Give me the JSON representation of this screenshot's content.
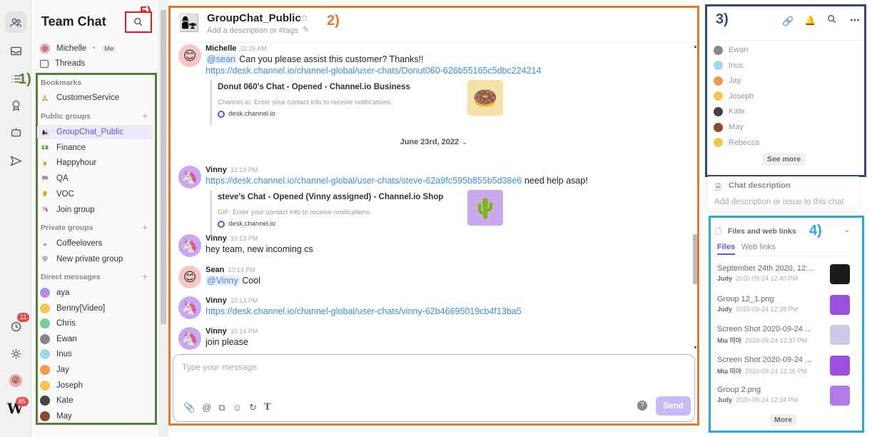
{
  "app": {
    "title": "Team Chat"
  },
  "rail": {
    "badge_notifications": "11",
    "badge_user": "85"
  },
  "sidebar": {
    "me": {
      "name": "Michelle",
      "tag": "Me"
    },
    "threads": "Threads",
    "bookmarks_label": "Bookmarks",
    "bookmarks": [
      {
        "label": "CustomerService",
        "icon": "🙏"
      }
    ],
    "public_label": "Public groups",
    "public_groups": [
      {
        "label": "GroupChat_Public",
        "icon": "👩‍👧"
      },
      {
        "label": "Finance",
        "icon": "💵"
      },
      {
        "label": "Happyhour",
        "icon": "🍺"
      },
      {
        "label": "QA",
        "icon": "🏁"
      },
      {
        "label": "VOC",
        "icon": "👂"
      },
      {
        "label": "Join group",
        "icon": "🦄"
      }
    ],
    "private_label": "Private groups",
    "private_groups": [
      {
        "label": "Coffeelovers",
        "icon": "☕"
      },
      {
        "label": "New private group",
        "icon": "😝"
      }
    ],
    "dm_label": "Direct messages",
    "dms": [
      {
        "label": "aya",
        "color": "#b78be8"
      },
      {
        "label": "Benny[Video]",
        "color": "#f2c94c"
      },
      {
        "label": "Chris",
        "color": "#6fcf97"
      },
      {
        "label": "Ewan",
        "color": "#888888"
      },
      {
        "label": "Inus",
        "color": "#9fd6f0"
      },
      {
        "label": "Jay",
        "color": "#f2994a"
      },
      {
        "label": "Joseph",
        "color": "#f2c94c"
      },
      {
        "label": "Kate",
        "color": "#444444"
      },
      {
        "label": "May",
        "color": "#8b4a2b"
      }
    ]
  },
  "annotations": {
    "a1": "1)",
    "a2": "2)",
    "a3": "3)",
    "a4": "4)",
    "a5": "5)"
  },
  "channel": {
    "name": "GroupChat_Public",
    "icon": "👩‍👧",
    "description_placeholder": "Add a description or #tags"
  },
  "messages": [
    {
      "name": "Michelle",
      "time": "11:26 AM",
      "mention": "@sean",
      "text": " Can you please assist this customer? Thanks!!",
      "link": "https://desk.channel.io/channel-global/user-chats/Donut060-626b55165c5dbc224214",
      "avatar": "😊",
      "card": {
        "title": "Donut 060's Chat - Opened - Channel.io Business",
        "sub": "Channel.io: Enter your contact info to receive notifications.",
        "domain": "desk.channel.io",
        "thumb": "🍩"
      }
    },
    {
      "name": "Vinny",
      "time": "12:19 PM",
      "link": "https://desk.channel.io/channel-global/user-chats/steve-62a9fc595b855b5d38e6",
      "text": " need help asap!",
      "avatar": "🦄",
      "card": {
        "title": "steve's Chat - Opened (Vinny assigned) - Channel.io Shop",
        "sub": "GIF: Enter your contact info to receive notifications.",
        "domain": "desk.channel.io",
        "thumb": "🌵"
      }
    },
    {
      "name": "Vinny",
      "time": "10:13 PM",
      "text": "hey team, new incoming cs",
      "avatar": "🦄"
    },
    {
      "name": "Sean",
      "time": "10:13 PM",
      "mention": "@Vinny",
      "text": "  Cool",
      "avatar": "😊"
    },
    {
      "name": "Vinny",
      "time": "10:13 PM",
      "link": "https://desk.channel.io/channel-global/user-chats/vinny-62b46695019cb4f13ba5",
      "avatar": "🦄"
    },
    {
      "name": "Vinny",
      "time": "10:14 PM",
      "text": "join please",
      "avatar": "🦄"
    }
  ],
  "date_separator": "June 23rd, 2022",
  "composer": {
    "placeholder": "Type your message.",
    "send": "Send",
    "help": "?"
  },
  "members": {
    "list": [
      {
        "name": "Ewan",
        "color": "#888888"
      },
      {
        "name": "Inus",
        "color": "#9fd6f0"
      },
      {
        "name": "Jay",
        "color": "#f2994a"
      },
      {
        "name": "Joseph",
        "color": "#f2c94c"
      },
      {
        "name": "Kate",
        "color": "#444444"
      },
      {
        "name": "May",
        "color": "#8b4a2b"
      },
      {
        "name": "Rebecca",
        "color": "#f2c94c"
      }
    ],
    "see_more": "See more"
  },
  "chat_description": {
    "title": "Chat description",
    "placeholder": "Add description or issue to this chat"
  },
  "files": {
    "title": "Files and web links",
    "tabs": [
      "Files",
      "Web links"
    ],
    "items": [
      {
        "name": "September 24th 2020, 12:...",
        "user": "Judy",
        "date": "2020-09-24 12:40 PM",
        "thumb": "#1a1a1a"
      },
      {
        "name": "Group 12_1.png",
        "user": "Judy",
        "date": "2020-09-24 12:38 PM",
        "thumb": "#9b51e0"
      },
      {
        "name": "Screen Shot 2020-09-24 ...",
        "user": "Mia 미아",
        "date": "2020-09-24 12:37 PM",
        "thumb": "#d0c8e8"
      },
      {
        "name": "Screen Shot 2020-09-24 ...",
        "user": "Mia 미아",
        "date": "2020-09-24 12:36 PM",
        "thumb": "#9b51e0"
      },
      {
        "name": "Group 2.png",
        "user": "Judy",
        "date": "2020-09-24 12:34 PM",
        "thumb": "#b37be8"
      }
    ],
    "more": "More"
  }
}
